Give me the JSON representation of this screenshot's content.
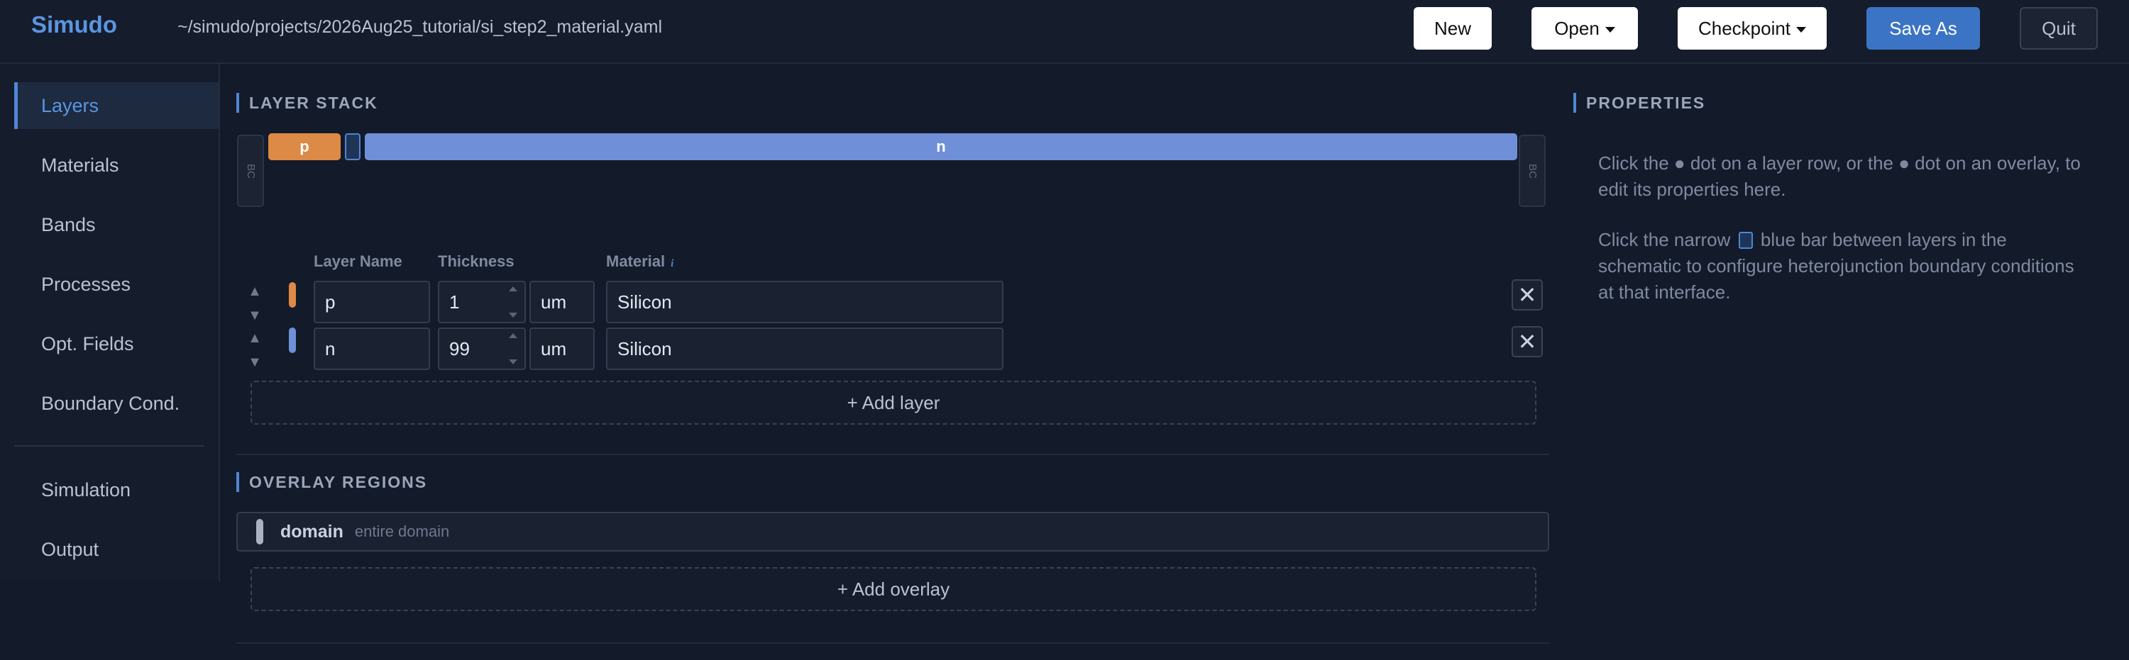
{
  "header": {
    "brand": "Simudo",
    "file_path": "~/simudo/projects/2026Aug25_tutorial/si_step2_material.yaml",
    "buttons": {
      "new": "New",
      "open": "Open",
      "checkpoint": "Checkpoint",
      "save_as": "Save As",
      "quit": "Quit"
    }
  },
  "sidebar": {
    "items": [
      {
        "label": "Layers",
        "active": true
      },
      {
        "label": "Materials"
      },
      {
        "label": "Bands"
      },
      {
        "label": "Processes"
      },
      {
        "label": "Opt. Fields"
      },
      {
        "label": "Boundary Cond."
      },
      {
        "label": "Simulation"
      },
      {
        "label": "Output"
      }
    ]
  },
  "layer_stack": {
    "title": "LAYER STACK",
    "bc_label": "BC",
    "bars": [
      {
        "label": "p",
        "color": "#dc8a45"
      },
      {
        "label": "n",
        "color": "#6f8fd8"
      }
    ],
    "columns": {
      "name": "Layer Name",
      "thickness": "Thickness",
      "material": "Material",
      "info_icon": "i"
    },
    "rows": [
      {
        "name": "p",
        "thickness": "1",
        "unit": "um",
        "material": "Silicon",
        "dot_color": "#dc8a45"
      },
      {
        "name": "n",
        "thickness": "99",
        "unit": "um",
        "material": "Silicon",
        "dot_color": "#6f8fd8"
      }
    ],
    "add_label": "+ Add layer",
    "move_up_glyph": "▲",
    "move_down_glyph": "▼",
    "delete_glyph": "✕"
  },
  "overlay_regions": {
    "title": "OVERLAY REGIONS",
    "items": [
      {
        "name": "domain",
        "description": "entire domain"
      }
    ],
    "add_label": "+ Add overlay"
  },
  "properties": {
    "title": "PROPERTIES",
    "hint1": "Click the ● dot on a layer row, or the ● dot on an overlay, to edit its properties here.",
    "hint2_before": "Click the narrow",
    "hint2_after": "blue bar between layers in the schematic to configure heterojunction boundary conditions at that interface."
  },
  "colors": {
    "accent": "#4f86d6",
    "primary_button": "#3b74c4",
    "p_layer": "#dc8a45",
    "n_layer": "#6f8fd8"
  }
}
